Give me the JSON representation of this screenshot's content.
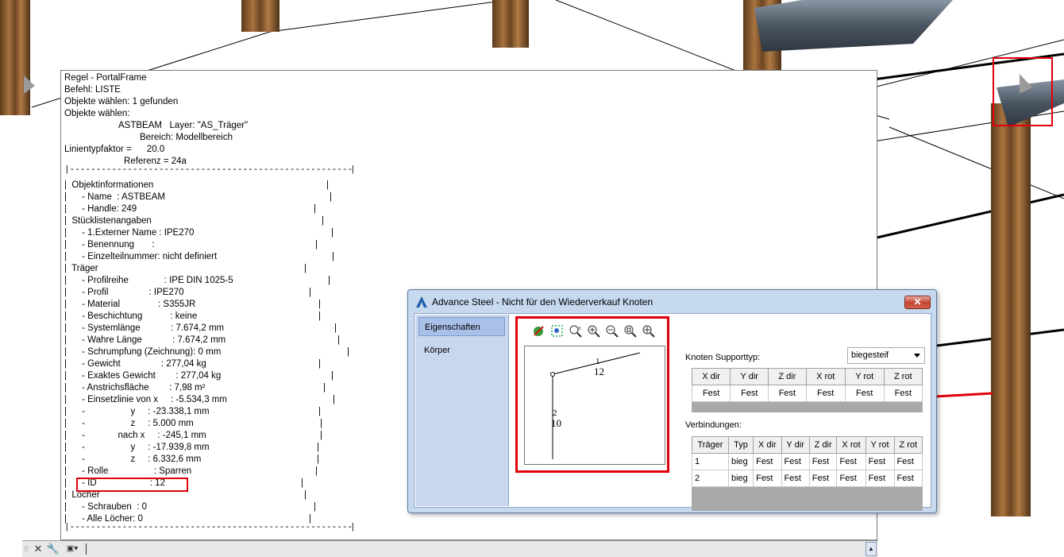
{
  "text_window": {
    "lines": [
      {
        "t": "Regel - PortalFrame",
        "x": 0
      },
      {
        "t": "Befehl: LISTE",
        "x": 0
      },
      {
        "t": "Objekte wählen: 1 gefunden",
        "x": 0
      },
      {
        "t": "Objekte wählen:",
        "x": 0
      },
      {
        "t": "ASTBEAM   Layer: \"AS_Träger\"",
        "x": 1
      },
      {
        "t": "Bereich: Modellbereich",
        "x": 2
      },
      {
        "t": "Linientypfaktor =      20.0",
        "x": 0
      },
      {
        "t": "Referenz = 24a",
        "x": 3
      }
    ],
    "tree": [
      "|  Objektinformationen",
      "|      - Name  : ASTBEAM",
      "|      - Handle: 249",
      "|  Stücklistenangaben",
      "|      - 1.Externer Name : IPE270",
      "|      - Benennung       :",
      "|      - Einzelteilnummer: nicht definiert",
      "|  Träger",
      "|      - Profilreihe              : IPE DIN 1025-5",
      "|      - Profil                : IPE270",
      "|      - Material               : S355JR",
      "|      - Beschichtung           : keine",
      "|      - Systemlänge            : 7.674,2 mm",
      "|      - Wahre Länge            : 7.674,2 mm",
      "|      - Schrumpfung (Zeichnung): 0 mm",
      "|      - Gewicht                : 277,04 kg",
      "|      - Exaktes Gewicht        : 277,04 kg",
      "|      - Anstrichsfläche        : 7,98 m²",
      "|      - Einsetzlinie von x     : -5.534,3 mm",
      "|      -                  y     : -23.338,1 mm",
      "|      -                  z     : 5.000 mm",
      "|      -             nach x     : -245,1 mm",
      "|      -                  y     : -17.939,8 mm",
      "|      -                  z     : 6.332,6 mm",
      "|      - Rolle                  : Sparren",
      "|      - ID                     : 12",
      "|  Löcher",
      "|      - Schrauben  : 0",
      "|      - Alle Löcher: 0"
    ]
  },
  "dialog": {
    "title": "Advance Steel - Nicht für den Wiederverkauf  Knoten",
    "close_label": "✕",
    "nav": [
      "Eigenschaften",
      "Körper"
    ],
    "preview_labels": {
      "beam1_top": "1",
      "beam1_bottom": "12",
      "beam2_top": "2",
      "beam2_bottom": "10"
    },
    "support_label": "Knoten Supporttyp:",
    "support_value": "biegesteif",
    "support_table": {
      "headers": [
        "X dir",
        "Y dir",
        "Z dir",
        "X rot",
        "Y rot",
        "Z rot"
      ],
      "row": [
        "Fest",
        "Fest",
        "Fest",
        "Fest",
        "Fest",
        "Fest"
      ]
    },
    "connections_label": "Verbindungen:",
    "connections_table": {
      "headers": [
        "Träger",
        "Typ",
        "X dir",
        "Y dir",
        "Z dir",
        "X rot",
        "Y rot",
        "Z rot"
      ],
      "rows": [
        [
          "1",
          "bieg",
          "Fest",
          "Fest",
          "Fest",
          "Fest",
          "Fest",
          "Fest"
        ],
        [
          "2",
          "bieg",
          "Fest",
          "Fest",
          "Fest",
          "Fest",
          "Fest",
          "Fest"
        ]
      ]
    }
  },
  "colors": {
    "highlight": "#e0000c",
    "wood": "#8a5a2b",
    "steel": "#4b5663"
  }
}
